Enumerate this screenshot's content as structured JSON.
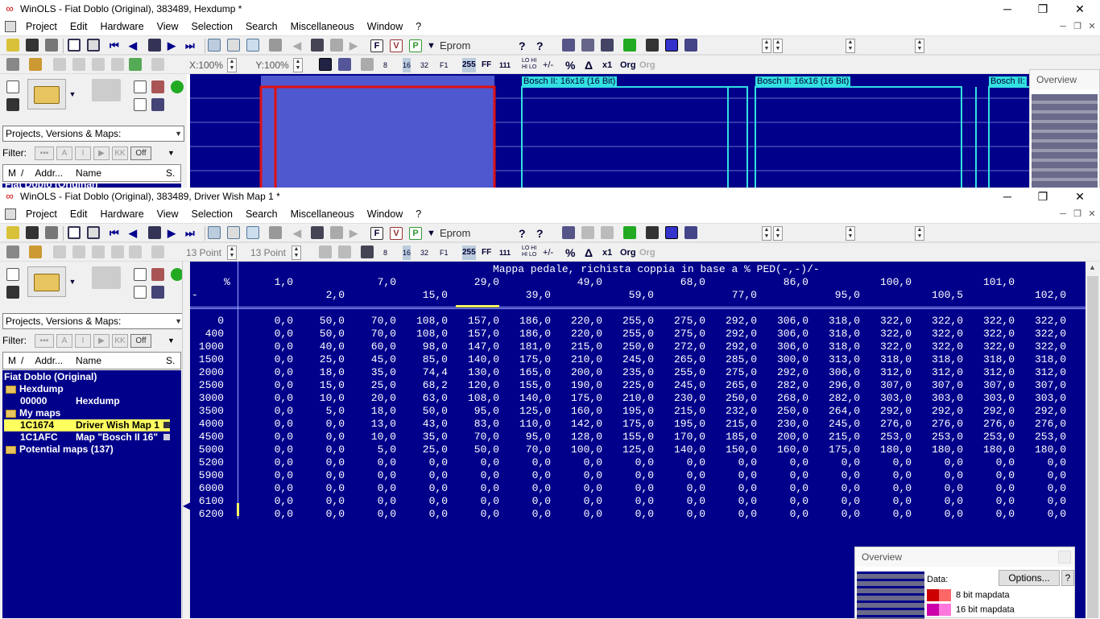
{
  "window1": {
    "title": "WinOLS - Fiat Doblo (Original), 383489, Hexdump *",
    "menu": [
      "Project",
      "Edit",
      "Hardware",
      "View",
      "Selection",
      "Search",
      "Miscellaneous",
      "Window",
      "?"
    ],
    "toolbar_eprom": "Eprom",
    "zoom_x": "X:100%",
    "zoom_y": "Y:100%",
    "combo": "Projects, Versions & Maps:",
    "filter_label": "Filter:",
    "filter_off": "Off",
    "cols": [
      "M",
      "/",
      "Addr...",
      "Name",
      "S."
    ],
    "tree_partial": "Fiat Doblo (Original)",
    "map_labels": [
      "Bosch II: 16x16 (16 Bit)",
      "Bosch II: 16x16 (16 Bit)",
      "Bosch II:"
    ],
    "overview_title": "Overview"
  },
  "window2": {
    "title": "WinOLS - Fiat Doblo (Original), 383489, Driver Wish Map 1 *",
    "menu": [
      "Project",
      "Edit",
      "Hardware",
      "View",
      "Selection",
      "Search",
      "Miscellaneous",
      "Window",
      "?"
    ],
    "toolbar_eprom": "Eprom",
    "font_a": "13 Point",
    "font_b": "13 Point",
    "combo": "Projects, Versions & Maps:",
    "filter_label": "Filter:",
    "filter_off": "Off",
    "cols": [
      "M",
      "/",
      "Addr...",
      "Name",
      "S."
    ],
    "tree": [
      {
        "type": "root",
        "text": "Fiat Doblo (Original)"
      },
      {
        "type": "folder",
        "text": "Hexdump"
      },
      {
        "type": "item",
        "addr": "00000",
        "name": "Hexdump"
      },
      {
        "type": "folder",
        "text": "My maps"
      },
      {
        "type": "item",
        "addr": "1C1674",
        "name": "Driver Wish Map 1",
        "selected": true
      },
      {
        "type": "item",
        "addr": "1C1AFC",
        "name": "Map \"Bosch II 16\""
      },
      {
        "type": "folder",
        "text": "Potential maps (137)"
      }
    ],
    "map": {
      "title": "Mappa pedale, richista coppia in base a % PED(-,-)/-",
      "corner_top": "%",
      "corner_bottom": "-",
      "x_top": [
        "1,0",
        "7,0",
        "29,0",
        "49,0",
        "68,0",
        "86,0",
        "100,0",
        "101,0"
      ],
      "x_bottom": [
        "2,0",
        "15,0",
        "39,0",
        "59,0",
        "77,0",
        "95,0",
        "100,5",
        "102,0"
      ],
      "y": [
        "0",
        "400",
        "1000",
        "1500",
        "2000",
        "2500",
        "3000",
        "3500",
        "4000",
        "4500",
        "5000",
        "5200",
        "5900",
        "6000",
        "6100",
        "6200"
      ],
      "rows": [
        [
          "0,0",
          "50,0",
          "70,0",
          "108,0",
          "157,0",
          "186,0",
          "220,0",
          "255,0",
          "275,0",
          "292,0",
          "306,0",
          "318,0",
          "322,0",
          "322,0",
          "322,0",
          "322,0"
        ],
        [
          "0,0",
          "50,0",
          "70,0",
          "108,0",
          "157,0",
          "186,0",
          "220,0",
          "255,0",
          "275,0",
          "292,0",
          "306,0",
          "318,0",
          "322,0",
          "322,0",
          "322,0",
          "322,0"
        ],
        [
          "0,0",
          "40,0",
          "60,0",
          "98,0",
          "147,0",
          "181,0",
          "215,0",
          "250,0",
          "272,0",
          "292,0",
          "306,0",
          "318,0",
          "322,0",
          "322,0",
          "322,0",
          "322,0"
        ],
        [
          "0,0",
          "25,0",
          "45,0",
          "85,0",
          "140,0",
          "175,0",
          "210,0",
          "245,0",
          "265,0",
          "285,0",
          "300,0",
          "313,0",
          "318,0",
          "318,0",
          "318,0",
          "318,0"
        ],
        [
          "0,0",
          "18,0",
          "35,0",
          "74,4",
          "130,0",
          "165,0",
          "200,0",
          "235,0",
          "255,0",
          "275,0",
          "292,0",
          "306,0",
          "312,0",
          "312,0",
          "312,0",
          "312,0"
        ],
        [
          "0,0",
          "15,0",
          "25,0",
          "68,2",
          "120,0",
          "155,0",
          "190,0",
          "225,0",
          "245,0",
          "265,0",
          "282,0",
          "296,0",
          "307,0",
          "307,0",
          "307,0",
          "307,0"
        ],
        [
          "0,0",
          "10,0",
          "20,0",
          "63,0",
          "108,0",
          "140,0",
          "175,0",
          "210,0",
          "230,0",
          "250,0",
          "268,0",
          "282,0",
          "303,0",
          "303,0",
          "303,0",
          "303,0"
        ],
        [
          "0,0",
          "5,0",
          "18,0",
          "50,0",
          "95,0",
          "125,0",
          "160,0",
          "195,0",
          "215,0",
          "232,0",
          "250,0",
          "264,0",
          "292,0",
          "292,0",
          "292,0",
          "292,0"
        ],
        [
          "0,0",
          "0,0",
          "13,0",
          "43,0",
          "83,0",
          "110,0",
          "142,0",
          "175,0",
          "195,0",
          "215,0",
          "230,0",
          "245,0",
          "276,0",
          "276,0",
          "276,0",
          "276,0"
        ],
        [
          "0,0",
          "0,0",
          "10,0",
          "35,0",
          "70,0",
          "95,0",
          "128,0",
          "155,0",
          "170,0",
          "185,0",
          "200,0",
          "215,0",
          "253,0",
          "253,0",
          "253,0",
          "253,0"
        ],
        [
          "0,0",
          "0,0",
          "5,0",
          "25,0",
          "50,0",
          "70,0",
          "100,0",
          "125,0",
          "140,0",
          "150,0",
          "160,0",
          "175,0",
          "180,0",
          "180,0",
          "180,0",
          "180,0"
        ],
        [
          "0,0",
          "0,0",
          "0,0",
          "0,0",
          "0,0",
          "0,0",
          "0,0",
          "0,0",
          "0,0",
          "0,0",
          "0,0",
          "0,0",
          "0,0",
          "0,0",
          "0,0",
          "0,0"
        ],
        [
          "0,0",
          "0,0",
          "0,0",
          "0,0",
          "0,0",
          "0,0",
          "0,0",
          "0,0",
          "0,0",
          "0,0",
          "0,0",
          "0,0",
          "0,0",
          "0,0",
          "0,0",
          "0,0"
        ],
        [
          "0,0",
          "0,0",
          "0,0",
          "0,0",
          "0,0",
          "0,0",
          "0,0",
          "0,0",
          "0,0",
          "0,0",
          "0,0",
          "0,0",
          "0,0",
          "0,0",
          "0,0",
          "0,0"
        ],
        [
          "0,0",
          "0,0",
          "0,0",
          "0,0",
          "0,0",
          "0,0",
          "0,0",
          "0,0",
          "0,0",
          "0,0",
          "0,0",
          "0,0",
          "0,0",
          "0,0",
          "0,0",
          "0,0"
        ],
        [
          "0,0",
          "0,0",
          "0,0",
          "0,0",
          "0,0",
          "0,0",
          "0,0",
          "0,0",
          "0,0",
          "0,0",
          "0,0",
          "0,0",
          "0,0",
          "0,0",
          "0,0",
          "0,0"
        ]
      ]
    },
    "overview": {
      "title": "Overview",
      "data_label": "Data:",
      "options": "Options...",
      "help": "?",
      "legend": [
        {
          "label": "8 bit mapdata",
          "c1": "#cc0000",
          "c2": "#ff6666"
        },
        {
          "label": "16 bit mapdata",
          "c1": "#cc00aa",
          "c2": "#ff77dd"
        }
      ]
    }
  },
  "colors": {
    "map_bg": "#00008b",
    "highlight": "#ffff60",
    "cyan": "#33e0e0",
    "red": "#e01010"
  }
}
